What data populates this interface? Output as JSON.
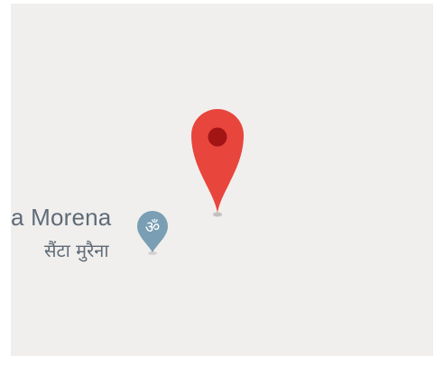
{
  "map": {
    "place": {
      "name": "a Morena",
      "name_local": "सैंटा मुरैना",
      "poi_icon": "om-temple-icon",
      "poi_color": "#7a9eb3"
    },
    "marker": {
      "icon": "location-pin-icon",
      "color": "#e8453c",
      "dot_color": "#a31515"
    },
    "background_color": "#f1efed"
  }
}
